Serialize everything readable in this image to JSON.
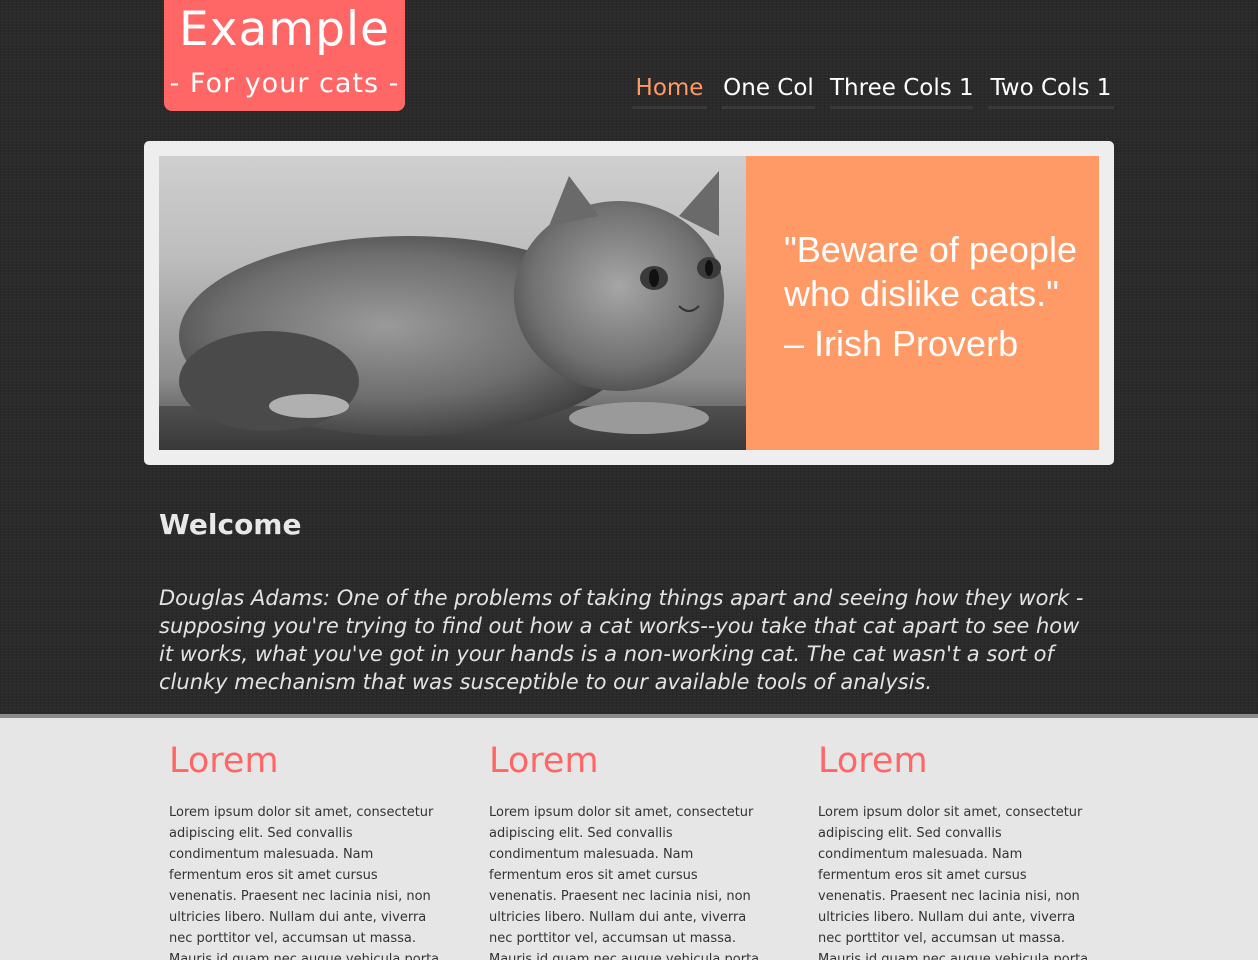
{
  "logo": {
    "title": "Example",
    "subtitle": "- For your cats -"
  },
  "nav": {
    "items": [
      {
        "label": "Home",
        "active": true
      },
      {
        "label": "One Col",
        "active": false
      },
      {
        "label": "Three Cols 1",
        "active": false
      },
      {
        "label": "Two Cols 1",
        "active": false
      }
    ]
  },
  "banner": {
    "quote": "\"Beware of people\nwho dislike cats.\"",
    "attribution": "– Irish Proverb",
    "photo_subject": "grey cat"
  },
  "main": {
    "heading": "Welcome",
    "intro": "Douglas Adams: One of the problems of taking things apart and seeing how they work - supposing you're trying to find out how a cat works--you take that cat apart to see how it works, what you've got in your hands is a non-working cat. The cat wasn't a sort of clunky mechanism that was susceptible to our available tools of analysis."
  },
  "columns": [
    {
      "heading": "Lorem",
      "text": "Lorem ipsum dolor sit amet, consectetur adipiscing elit. Sed convallis condimentum malesuada. Nam fermentum eros sit amet cursus venenatis. Praesent nec lacinia nisi, non ultricies libero. Nullam dui ante, viverra nec porttitor vel, accumsan ut massa. Mauris id quam nec augue vehicula porta vel eget orci. Phasellus ultricies"
    },
    {
      "heading": "Lorem",
      "text": "Lorem ipsum dolor sit amet, consectetur adipiscing elit. Sed convallis condimentum malesuada. Nam fermentum eros sit amet cursus venenatis. Praesent nec lacinia nisi, non ultricies libero. Nullam dui ante, viverra nec porttitor vel, accumsan ut massa. Mauris id quam nec augue vehicula porta vel eget orci. Phasellus ultricies turpis"
    },
    {
      "heading": "Lorem",
      "text": "Lorem ipsum dolor sit amet, consectetur adipiscing elit. Sed convallis condimentum malesuada. Nam fermentum eros sit amet cursus venenatis. Praesent nec lacinia nisi, non ultricies libero. Nullam dui ante, viverra nec porttitor vel, accumsan ut massa. Mauris id quam nec augue vehicula porta vel eget orci. Phasellus ultricies"
    }
  ],
  "colors": {
    "accent": "#ff6666",
    "nav_active": "#ff9966",
    "quote_bg": "#ff9966",
    "dark_bg": "#2a2a2a",
    "light_bg": "#e6e6e6"
  }
}
